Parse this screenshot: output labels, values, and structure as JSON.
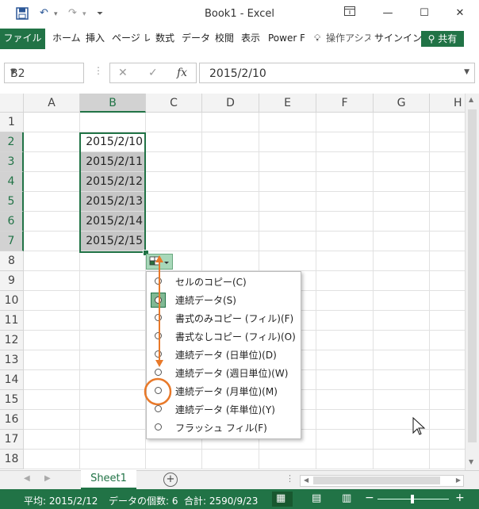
{
  "app": {
    "title": "Book1 - Excel"
  },
  "ribbon": {
    "tabs": [
      "ファイル",
      "ホーム",
      "挿入",
      "ページ レ",
      "数式",
      "データ",
      "校閲",
      "表示",
      "Power F"
    ],
    "tell_me": "操作アシス",
    "signin": "サインイン",
    "share": "共有"
  },
  "formula_bar": {
    "name_box": "B2",
    "fx_label": "fx",
    "formula": "2015/2/10"
  },
  "grid": {
    "columns": [
      "A",
      "B",
      "C",
      "D",
      "E",
      "F",
      "G",
      "H"
    ],
    "rows": [
      "1",
      "2",
      "3",
      "4",
      "5",
      "6",
      "7",
      "8",
      "9",
      "10",
      "11",
      "12",
      "13",
      "14",
      "15",
      "16",
      "17",
      "18"
    ],
    "b_values": [
      "2015/2/10",
      "2015/2/11",
      "2015/2/12",
      "2015/2/13",
      "2015/2/14",
      "2015/2/15"
    ]
  },
  "autofill_menu": {
    "selected_index": 1,
    "items": [
      "セルのコピー(C)",
      "連続データ(S)",
      "書式のみコピー (フィル)(F)",
      "書式なしコピー (フィル)(O)",
      "連続データ (日単位)(D)",
      "連続データ (週日単位)(W)",
      "連続データ (月単位)(M)",
      "連続データ (年単位)(Y)",
      "フラッシュ フィル(F)"
    ]
  },
  "sheet_tabs": {
    "active": "Sheet1"
  },
  "status_bar": {
    "average": "平均: 2015/2/12",
    "count": "データの個数: 6",
    "sum": "合計: 2590/9/23"
  },
  "colors": {
    "accent": "#217346",
    "annotation": "#e8792a"
  }
}
